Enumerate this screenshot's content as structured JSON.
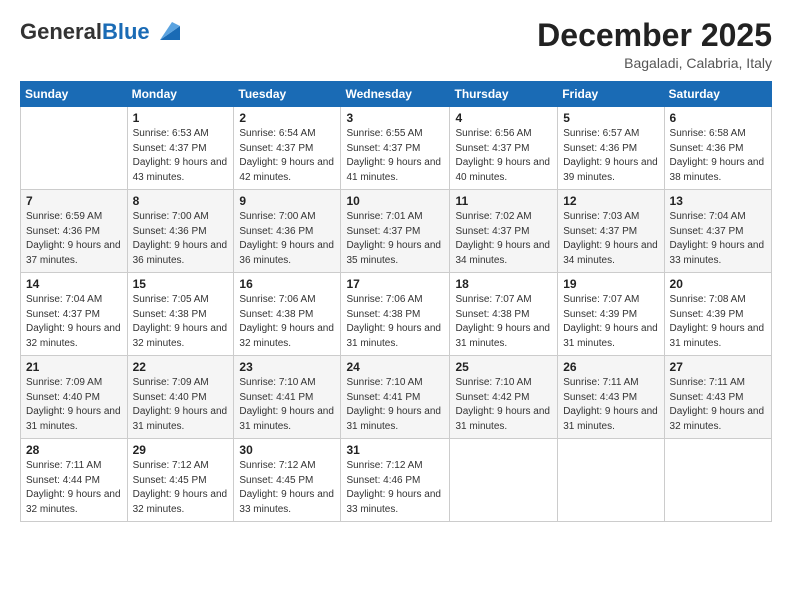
{
  "logo": {
    "general": "General",
    "blue": "Blue"
  },
  "title": "December 2025",
  "location": "Bagaladi, Calabria, Italy",
  "headers": [
    "Sunday",
    "Monday",
    "Tuesday",
    "Wednesday",
    "Thursday",
    "Friday",
    "Saturday"
  ],
  "weeks": [
    [
      {
        "day": "",
        "sunrise": "",
        "sunset": "",
        "daylight": ""
      },
      {
        "day": "1",
        "sunrise": "Sunrise: 6:53 AM",
        "sunset": "Sunset: 4:37 PM",
        "daylight": "Daylight: 9 hours and 43 minutes."
      },
      {
        "day": "2",
        "sunrise": "Sunrise: 6:54 AM",
        "sunset": "Sunset: 4:37 PM",
        "daylight": "Daylight: 9 hours and 42 minutes."
      },
      {
        "day": "3",
        "sunrise": "Sunrise: 6:55 AM",
        "sunset": "Sunset: 4:37 PM",
        "daylight": "Daylight: 9 hours and 41 minutes."
      },
      {
        "day": "4",
        "sunrise": "Sunrise: 6:56 AM",
        "sunset": "Sunset: 4:37 PM",
        "daylight": "Daylight: 9 hours and 40 minutes."
      },
      {
        "day": "5",
        "sunrise": "Sunrise: 6:57 AM",
        "sunset": "Sunset: 4:36 PM",
        "daylight": "Daylight: 9 hours and 39 minutes."
      },
      {
        "day": "6",
        "sunrise": "Sunrise: 6:58 AM",
        "sunset": "Sunset: 4:36 PM",
        "daylight": "Daylight: 9 hours and 38 minutes."
      }
    ],
    [
      {
        "day": "7",
        "sunrise": "Sunrise: 6:59 AM",
        "sunset": "Sunset: 4:36 PM",
        "daylight": "Daylight: 9 hours and 37 minutes."
      },
      {
        "day": "8",
        "sunrise": "Sunrise: 7:00 AM",
        "sunset": "Sunset: 4:36 PM",
        "daylight": "Daylight: 9 hours and 36 minutes."
      },
      {
        "day": "9",
        "sunrise": "Sunrise: 7:00 AM",
        "sunset": "Sunset: 4:36 PM",
        "daylight": "Daylight: 9 hours and 36 minutes."
      },
      {
        "day": "10",
        "sunrise": "Sunrise: 7:01 AM",
        "sunset": "Sunset: 4:37 PM",
        "daylight": "Daylight: 9 hours and 35 minutes."
      },
      {
        "day": "11",
        "sunrise": "Sunrise: 7:02 AM",
        "sunset": "Sunset: 4:37 PM",
        "daylight": "Daylight: 9 hours and 34 minutes."
      },
      {
        "day": "12",
        "sunrise": "Sunrise: 7:03 AM",
        "sunset": "Sunset: 4:37 PM",
        "daylight": "Daylight: 9 hours and 34 minutes."
      },
      {
        "day": "13",
        "sunrise": "Sunrise: 7:04 AM",
        "sunset": "Sunset: 4:37 PM",
        "daylight": "Daylight: 9 hours and 33 minutes."
      }
    ],
    [
      {
        "day": "14",
        "sunrise": "Sunrise: 7:04 AM",
        "sunset": "Sunset: 4:37 PM",
        "daylight": "Daylight: 9 hours and 32 minutes."
      },
      {
        "day": "15",
        "sunrise": "Sunrise: 7:05 AM",
        "sunset": "Sunset: 4:38 PM",
        "daylight": "Daylight: 9 hours and 32 minutes."
      },
      {
        "day": "16",
        "sunrise": "Sunrise: 7:06 AM",
        "sunset": "Sunset: 4:38 PM",
        "daylight": "Daylight: 9 hours and 32 minutes."
      },
      {
        "day": "17",
        "sunrise": "Sunrise: 7:06 AM",
        "sunset": "Sunset: 4:38 PM",
        "daylight": "Daylight: 9 hours and 31 minutes."
      },
      {
        "day": "18",
        "sunrise": "Sunrise: 7:07 AM",
        "sunset": "Sunset: 4:38 PM",
        "daylight": "Daylight: 9 hours and 31 minutes."
      },
      {
        "day": "19",
        "sunrise": "Sunrise: 7:07 AM",
        "sunset": "Sunset: 4:39 PM",
        "daylight": "Daylight: 9 hours and 31 minutes."
      },
      {
        "day": "20",
        "sunrise": "Sunrise: 7:08 AM",
        "sunset": "Sunset: 4:39 PM",
        "daylight": "Daylight: 9 hours and 31 minutes."
      }
    ],
    [
      {
        "day": "21",
        "sunrise": "Sunrise: 7:09 AM",
        "sunset": "Sunset: 4:40 PM",
        "daylight": "Daylight: 9 hours and 31 minutes."
      },
      {
        "day": "22",
        "sunrise": "Sunrise: 7:09 AM",
        "sunset": "Sunset: 4:40 PM",
        "daylight": "Daylight: 9 hours and 31 minutes."
      },
      {
        "day": "23",
        "sunrise": "Sunrise: 7:10 AM",
        "sunset": "Sunset: 4:41 PM",
        "daylight": "Daylight: 9 hours and 31 minutes."
      },
      {
        "day": "24",
        "sunrise": "Sunrise: 7:10 AM",
        "sunset": "Sunset: 4:41 PM",
        "daylight": "Daylight: 9 hours and 31 minutes."
      },
      {
        "day": "25",
        "sunrise": "Sunrise: 7:10 AM",
        "sunset": "Sunset: 4:42 PM",
        "daylight": "Daylight: 9 hours and 31 minutes."
      },
      {
        "day": "26",
        "sunrise": "Sunrise: 7:11 AM",
        "sunset": "Sunset: 4:43 PM",
        "daylight": "Daylight: 9 hours and 31 minutes."
      },
      {
        "day": "27",
        "sunrise": "Sunrise: 7:11 AM",
        "sunset": "Sunset: 4:43 PM",
        "daylight": "Daylight: 9 hours and 32 minutes."
      }
    ],
    [
      {
        "day": "28",
        "sunrise": "Sunrise: 7:11 AM",
        "sunset": "Sunset: 4:44 PM",
        "daylight": "Daylight: 9 hours and 32 minutes."
      },
      {
        "day": "29",
        "sunrise": "Sunrise: 7:12 AM",
        "sunset": "Sunset: 4:45 PM",
        "daylight": "Daylight: 9 hours and 32 minutes."
      },
      {
        "day": "30",
        "sunrise": "Sunrise: 7:12 AM",
        "sunset": "Sunset: 4:45 PM",
        "daylight": "Daylight: 9 hours and 33 minutes."
      },
      {
        "day": "31",
        "sunrise": "Sunrise: 7:12 AM",
        "sunset": "Sunset: 4:46 PM",
        "daylight": "Daylight: 9 hours and 33 minutes."
      },
      {
        "day": "",
        "sunrise": "",
        "sunset": "",
        "daylight": ""
      },
      {
        "day": "",
        "sunrise": "",
        "sunset": "",
        "daylight": ""
      },
      {
        "day": "",
        "sunrise": "",
        "sunset": "",
        "daylight": ""
      }
    ]
  ]
}
